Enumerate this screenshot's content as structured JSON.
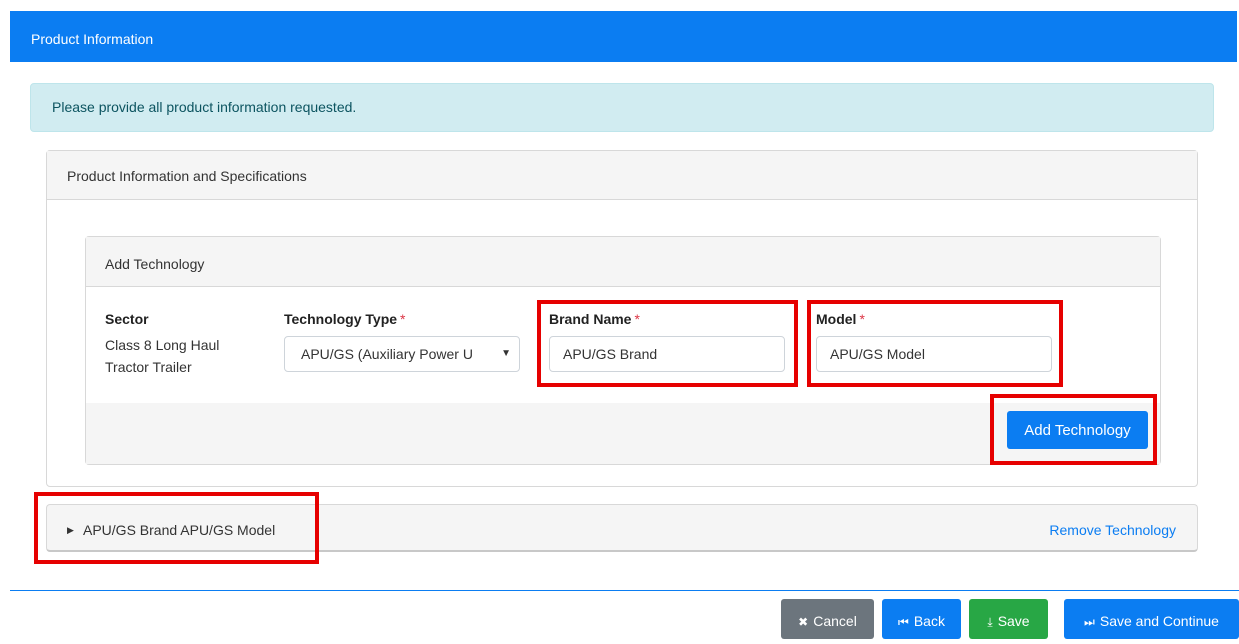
{
  "header": {
    "title": "Product Information"
  },
  "alert": {
    "text": "Please provide all product information requested."
  },
  "specs_card": {
    "title": "Product Information and Specifications"
  },
  "add_tech": {
    "title": "Add Technology",
    "sector": {
      "label": "Sector",
      "value": "Class 8 Long Haul Tractor Trailer"
    },
    "technology_type": {
      "label": "Technology Type",
      "required": "*",
      "selected": "APU/GS (Auxiliary Power U"
    },
    "brand_name": {
      "label": "Brand Name",
      "required": "*",
      "value": "APU/GS Brand"
    },
    "model": {
      "label": "Model",
      "required": "*",
      "value": "APU/GS Model"
    },
    "add_button": "Add Technology"
  },
  "tech_list": [
    {
      "label": "APU/GS Brand APU/GS Model",
      "remove": "Remove Technology"
    }
  ],
  "footer": {
    "cancel": "Cancel",
    "back": "Back",
    "save": "Save",
    "save_continue": "Save and Continue"
  },
  "colors": {
    "primary": "#0b7df2",
    "success": "#28a745",
    "secondary": "#6c757d",
    "highlight": "#e60000",
    "alert_bg": "#d1ecf1"
  },
  "icons": {
    "cancel": "close-icon",
    "back": "skip-back-icon",
    "save": "download-icon",
    "save_continue": "skip-forward-icon",
    "expand": "caret-right-icon"
  }
}
